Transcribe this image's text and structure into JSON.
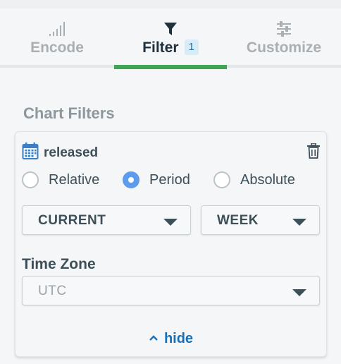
{
  "tabs": [
    {
      "label": "Encode",
      "icon": "signal-bars-icon"
    },
    {
      "label": "Filter",
      "icon": "funnel-icon",
      "badge": "1"
    },
    {
      "label": "Customize",
      "icon": "sliders-icon"
    }
  ],
  "colors": {
    "active_tab_underline": "#3fa554",
    "accent": "#5d9cec",
    "link": "#1a70b8"
  },
  "section_title": "Chart Filters",
  "filter": {
    "field_icon": "calendar-icon",
    "field_name": "released",
    "delete_icon": "trash-icon",
    "modes": [
      "Relative",
      "Period",
      "Absolute"
    ],
    "selected_mode": "Period",
    "period_value": "CURRENT",
    "period_unit": "WEEK",
    "timezone_label": "Time Zone",
    "timezone_value": "UTC",
    "hide_label": "hide"
  }
}
